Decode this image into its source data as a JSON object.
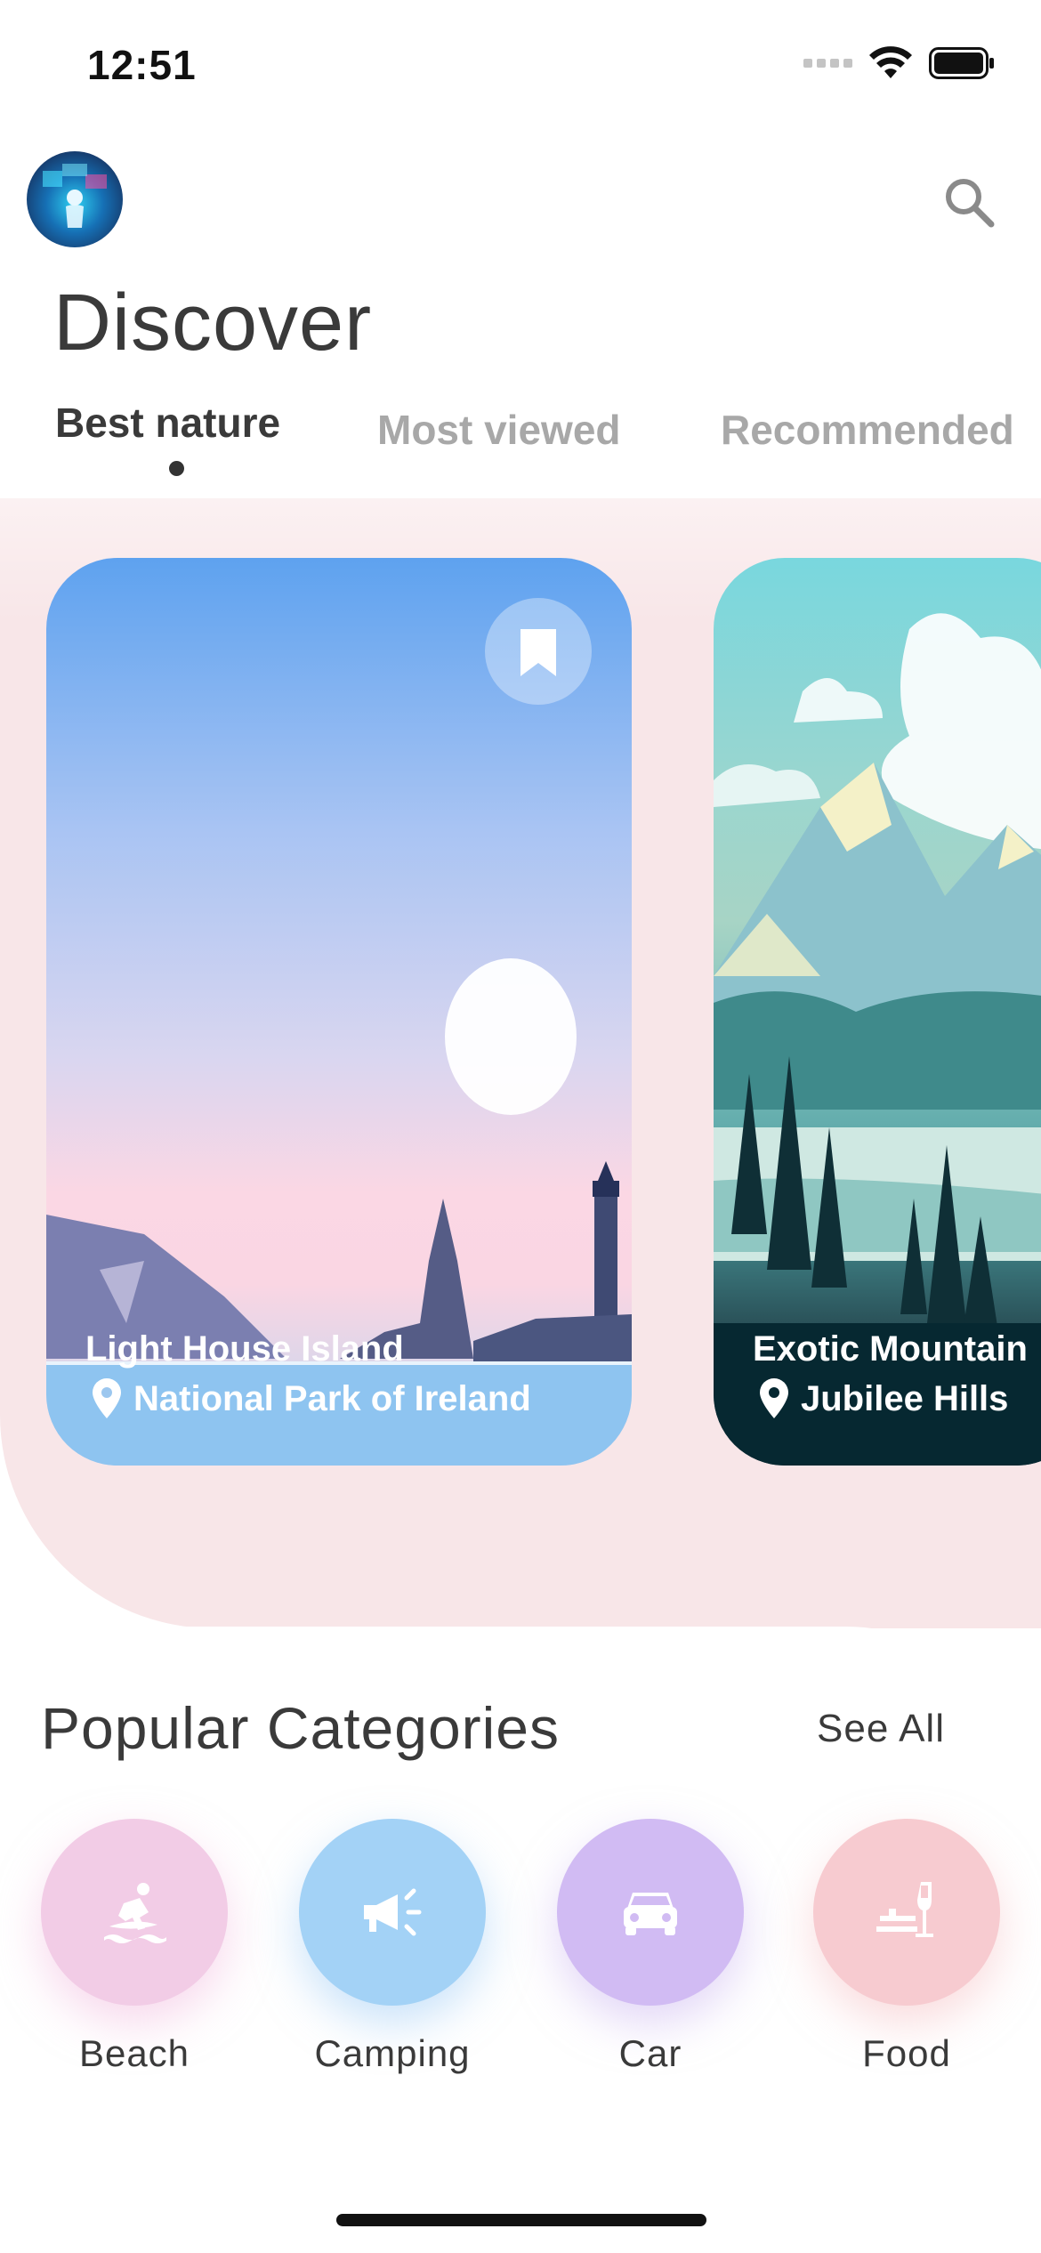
{
  "status_bar": {
    "time": "12:51"
  },
  "header": {
    "title": "Discover"
  },
  "tabs": [
    {
      "label": "Best nature",
      "active": true
    },
    {
      "label": "Most viewed",
      "active": false
    },
    {
      "label": "Recommended",
      "active": false
    }
  ],
  "cards": [
    {
      "title": "Light House Island",
      "location": "National Park of Ireland"
    },
    {
      "title": "Exotic Mountain",
      "location": "Jubilee Hills"
    }
  ],
  "categories_section": {
    "title": "Popular Categories",
    "see_all": "See All",
    "items": [
      {
        "label": "Beach",
        "icon": "surfing-icon",
        "color": "#f2c8e6"
      },
      {
        "label": "Camping",
        "icon": "megaphone-icon",
        "color": "#9fd0f5"
      },
      {
        "label": "Car",
        "icon": "car-icon",
        "color": "#cfb8f2"
      },
      {
        "label": "Food",
        "icon": "dining-icon",
        "color": "#f6c9cf"
      }
    ]
  }
}
